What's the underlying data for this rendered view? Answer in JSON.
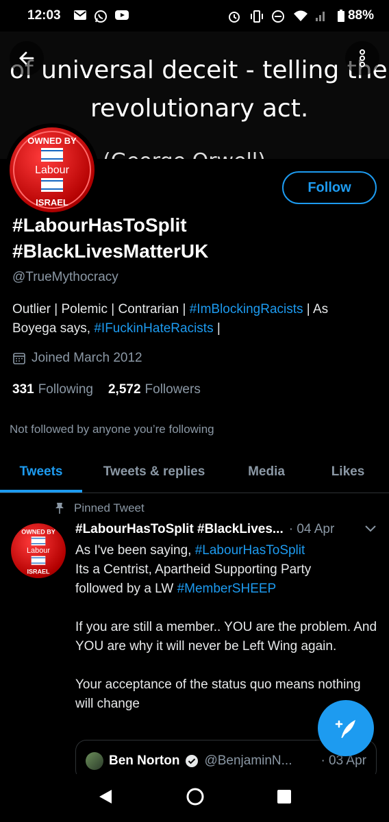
{
  "status_bar": {
    "time": "12:03",
    "battery": "88%",
    "left_icons": [
      "gmail-icon",
      "whatsapp-icon",
      "youtube-icon"
    ],
    "right_icons": [
      "alarm-icon",
      "vibrate-icon",
      "dnd-icon",
      "wifi-icon",
      "signal-icon",
      "battery-icon"
    ]
  },
  "banner": {
    "line1": "of universal deceit - telling the t",
    "line2": "revolutionary act.",
    "line3": "(George Orwell)"
  },
  "avatar": {
    "top_text": "OWNED BY",
    "middle_text": "Labour",
    "bottom_text": "ISRAEL"
  },
  "profile": {
    "follow_label": "Follow",
    "display_name": "#LabourHasToSplit #BlackLivesMatterUK",
    "handle": "@TrueMythocracy",
    "bio_plain1": "Outlier | Polemic | Contrarian | ",
    "bio_link1": "#ImBlockingRacists",
    "bio_plain2": " | As Boyega says, ",
    "bio_link2": "#IFuckinHateRacists",
    "bio_plain3": " |",
    "joined": "Joined March 2012",
    "following_count": "331",
    "following_label": "Following",
    "followers_count": "2,572",
    "followers_label": "Followers",
    "not_followed": "Not followed by anyone you’re following"
  },
  "tabs": [
    {
      "label": "Tweets",
      "active": true
    },
    {
      "label": "Tweets & replies",
      "active": false
    },
    {
      "label": "Media",
      "active": false
    },
    {
      "label": "Likes",
      "active": false
    }
  ],
  "tweet": {
    "pinned_label": "Pinned Tweet",
    "name": "#LabourHasToSplit #BlackLives...",
    "date": "· 04 Apr",
    "line1_plain": "As I've been saying, ",
    "line1_link": "#LabourHasToSplit",
    "line2": "Its a Centrist, Apartheid Supporting Party",
    "line3_plain": "followed by a LW ",
    "line3_link": "#MemberSHEEP",
    "para2": "If you are still a member.. YOU are the problem. And YOU are why it will never be Left Wing again.",
    "para3": "Your acceptance of the status quo means nothing will change"
  },
  "quote": {
    "name": "Ben Norton",
    "handle": "@BenjaminN...",
    "date": "· 03 Apr"
  },
  "colors": {
    "accent": "#1d9bf0",
    "background": "#000000",
    "muted": "#8b98a5",
    "avatar_red": "#d90000"
  }
}
